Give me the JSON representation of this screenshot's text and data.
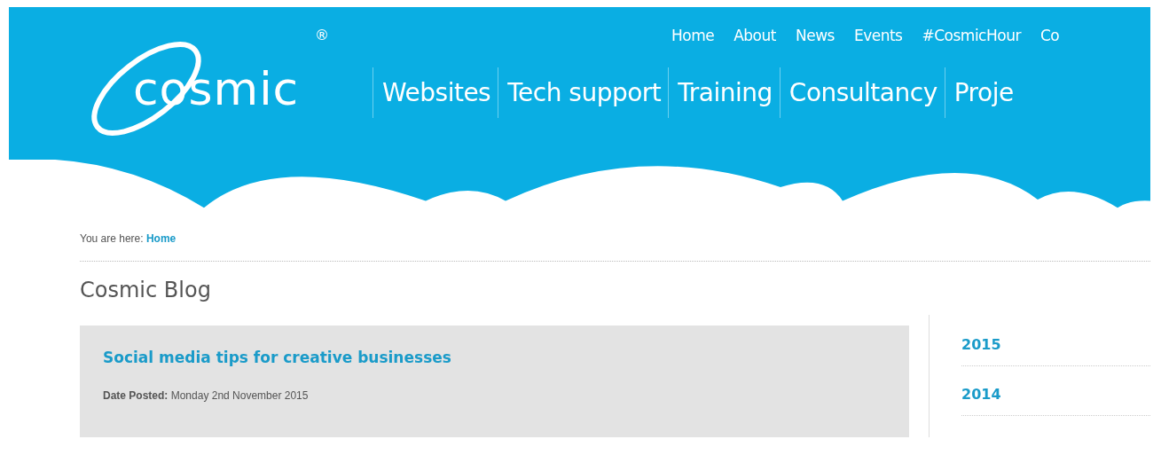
{
  "logo": {
    "text": "cosmic",
    "registered": "®"
  },
  "top_nav": [
    "Home",
    "About",
    "News",
    "Events",
    "#CosmicHour",
    "Co"
  ],
  "main_nav": [
    "Websites",
    "Tech support",
    "Training",
    "Consultancy",
    "Proje"
  ],
  "breadcrumb": {
    "label": "You are here:",
    "link": "Home"
  },
  "page_title": "Cosmic Blog",
  "posts": [
    {
      "title": "Social media tips for creative businesses",
      "date_label": "Date Posted:",
      "date": "Monday 2nd November 2015"
    }
  ],
  "archive_years": [
    "2015",
    "2014"
  ]
}
